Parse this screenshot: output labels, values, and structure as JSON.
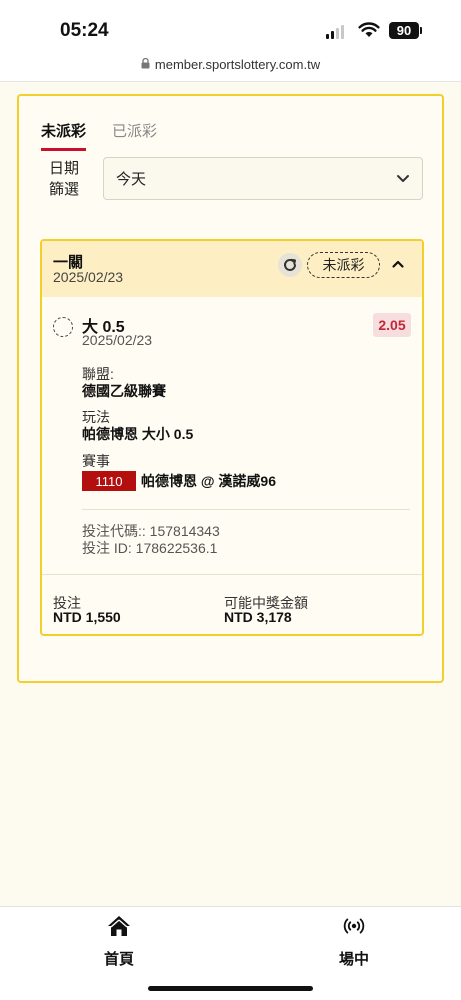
{
  "status_bar": {
    "time": "05:24",
    "battery": "90"
  },
  "browser": {
    "url": "member.sportslottery.com.tw"
  },
  "tabs": [
    {
      "label": "未派彩",
      "active": true
    },
    {
      "label": "已派彩",
      "active": false
    }
  ],
  "filter": {
    "label_line1": "日期",
    "label_line2": "篩選",
    "selected": "今天"
  },
  "bet": {
    "type": "一關",
    "date": "2025/02/23",
    "status": "未派彩",
    "selection": {
      "name": "大 0.5",
      "date": "2025/02/23",
      "odds": "2.05"
    },
    "league_label": "聯盟:",
    "league_value": "德國乙級聯賽",
    "market_label": "玩法",
    "market_value": "帕德博恩 大小 0.5",
    "event_label": "賽事",
    "event_id": "1110",
    "event_name": "帕德博恩 @ 漢諾威96",
    "bet_code": "投注代碼:: 157814343",
    "bet_id": "投注 ID: 178622536.1",
    "stake_label": "投注",
    "stake_value": "NTD 1,550",
    "payout_label": "可能中獎金額",
    "payout_value": "NTD 3,178"
  },
  "bottom_nav": [
    {
      "label": "首頁",
      "icon": "home-icon"
    },
    {
      "label": "場中",
      "icon": "live-broadcast-icon"
    }
  ],
  "colors": {
    "accent_yellow": "#f2cf2a",
    "tab_underline": "#c8102e",
    "event_badge": "#b30f0f",
    "odds_text": "#c0283a"
  }
}
